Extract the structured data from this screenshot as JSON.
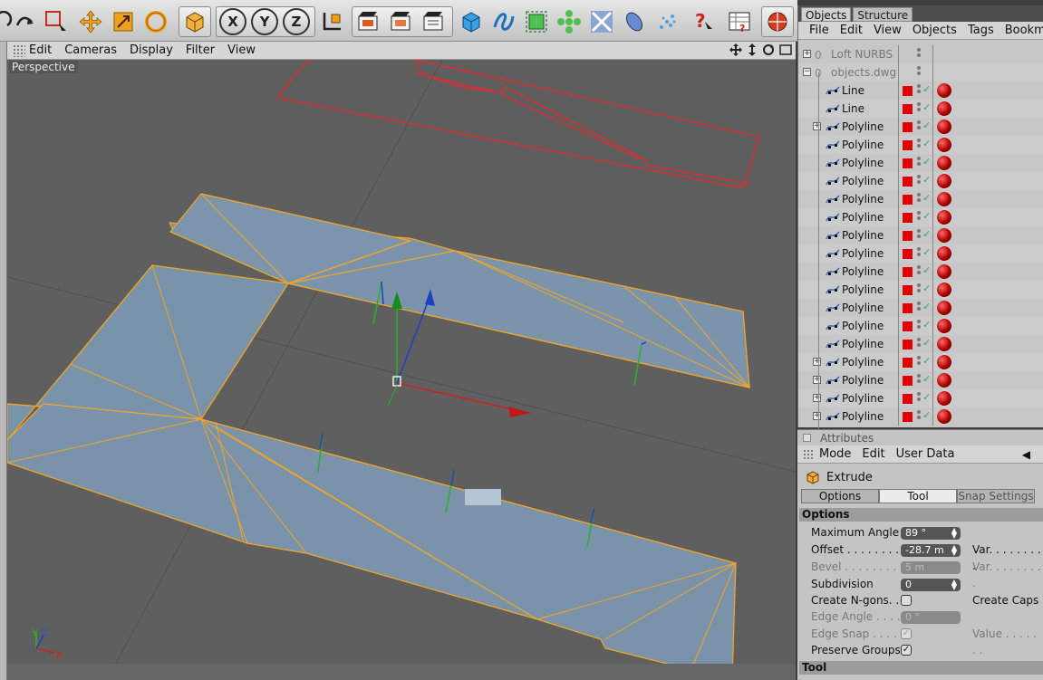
{
  "viewport": {
    "menu": [
      "Edit",
      "Cameras",
      "Display",
      "Filter",
      "View"
    ],
    "label": "Perspective",
    "axis_gizmo": {
      "y": "Y",
      "z": "Z",
      "x": "X"
    }
  },
  "toolbar": {
    "axis_buttons": [
      "X",
      "Y",
      "Z"
    ]
  },
  "object_manager": {
    "tabs": [
      "Objects",
      "Structure"
    ],
    "active_tab": "Objects",
    "menu": [
      "File",
      "Edit",
      "View",
      "Objects",
      "Tags",
      "Bookm"
    ],
    "items": [
      {
        "name": "Loft NURBS",
        "dimmed": true,
        "expand": "+",
        "indent": 0
      },
      {
        "name": "objects.dwg",
        "dimmed": true,
        "expand": "-",
        "indent": 0
      },
      {
        "name": "Line",
        "expand": "",
        "indent": 1
      },
      {
        "name": "Line",
        "expand": "",
        "indent": 1
      },
      {
        "name": "Polyline",
        "expand": "+",
        "indent": 1
      },
      {
        "name": "Polyline",
        "expand": "",
        "indent": 1
      },
      {
        "name": "Polyline",
        "expand": "",
        "indent": 1
      },
      {
        "name": "Polyline",
        "expand": "",
        "indent": 1
      },
      {
        "name": "Polyline",
        "expand": "",
        "indent": 1
      },
      {
        "name": "Polyline",
        "expand": "",
        "indent": 1
      },
      {
        "name": "Polyline",
        "expand": "",
        "indent": 1
      },
      {
        "name": "Polyline",
        "expand": "",
        "indent": 1
      },
      {
        "name": "Polyline",
        "expand": "",
        "indent": 1
      },
      {
        "name": "Polyline",
        "expand": "",
        "indent": 1
      },
      {
        "name": "Polyline",
        "expand": "",
        "indent": 1
      },
      {
        "name": "Polyline",
        "expand": "",
        "indent": 1
      },
      {
        "name": "Polyline",
        "expand": "",
        "indent": 1
      },
      {
        "name": "Polyline",
        "expand": "+",
        "indent": 1
      },
      {
        "name": "Polyline",
        "expand": "+",
        "indent": 1
      },
      {
        "name": "Polyline",
        "expand": "+",
        "indent": 1
      },
      {
        "name": "Polyline",
        "expand": "+",
        "indent": 1
      }
    ]
  },
  "attributes": {
    "header": "Attributes",
    "menu": [
      "Mode",
      "Edit",
      "User Data"
    ],
    "tool_name": "Extrude",
    "tabs": [
      "Options",
      "Tool",
      "Snap Settings"
    ],
    "active_tab": "Tool",
    "section_options": "Options",
    "section_tool": "Tool",
    "props": {
      "max_angle_label": "Maximum Angle",
      "max_angle_value": "89 °",
      "offset_label": "Offset . . . . . . . . . . .",
      "offset_value": "-28.7 m",
      "bevel_label": "Bevel . . . . . . . . . . . .",
      "bevel_value": "5 m",
      "subdivision_label": "Subdivision",
      "subdivision_value": "0",
      "ngons_label": "Create N-gons. .",
      "edge_angle_label": "Edge Angle . . . . .",
      "edge_angle_value": "0 °",
      "edge_snap_label": "Edge Snap . . . . . .",
      "preserve_label": "Preserve Groups",
      "var1_label": "Var. . . . . . . . .",
      "var2_label": "Var. . . . . . . . .",
      "caps_label": "Create Caps",
      "value_label": "Value . . . . . . ."
    }
  },
  "colors": {
    "viewport_bg": "#5f5f5f",
    "mesh_fill": "#7b93aa",
    "mesh_edge": "#f5a623",
    "spline_red": "#e02020",
    "axis_x": "#d02020",
    "axis_y": "#2ab02a",
    "axis_z": "#2040c0",
    "object_layer_red": "#e00000"
  }
}
